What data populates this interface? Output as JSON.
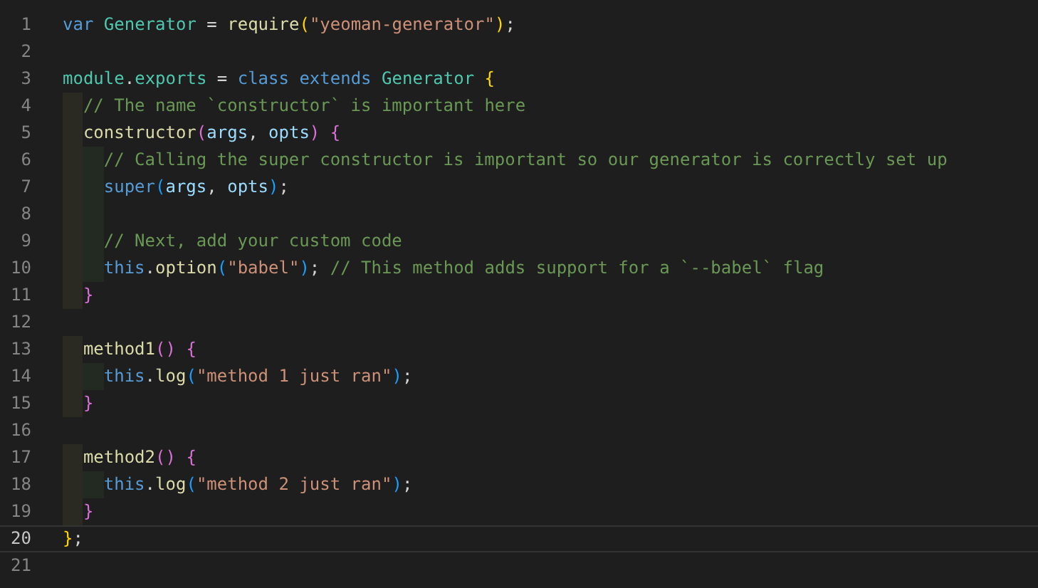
{
  "editor": {
    "lines": [
      {
        "number": "1",
        "current": false,
        "tokens": [
          {
            "kind": "keyword",
            "text": "var "
          },
          {
            "kind": "class",
            "text": "Generator"
          },
          {
            "kind": "plain",
            "text": " = "
          },
          {
            "kind": "function",
            "text": "require"
          },
          {
            "kind": "bracket1",
            "text": "("
          },
          {
            "kind": "string",
            "text": "\"yeoman-generator\""
          },
          {
            "kind": "bracket1",
            "text": ")"
          },
          {
            "kind": "plain",
            "text": ";"
          }
        ]
      },
      {
        "number": "2",
        "current": false
      },
      {
        "number": "3",
        "current": false,
        "tokens": [
          {
            "kind": "class",
            "text": "module"
          },
          {
            "kind": "plain",
            "text": "."
          },
          {
            "kind": "class",
            "text": "exports"
          },
          {
            "kind": "plain",
            "text": " = "
          },
          {
            "kind": "keyword",
            "text": "class extends "
          },
          {
            "kind": "class",
            "text": "Generator "
          },
          {
            "kind": "bracket1",
            "text": "{"
          }
        ]
      },
      {
        "number": "4",
        "current": false,
        "guides": [
          {
            "kind": "outer"
          }
        ],
        "tokens": [
          {
            "kind": "comment",
            "text": "// The name `constructor` is important here"
          }
        ]
      },
      {
        "number": "5",
        "current": false,
        "guides": [
          {
            "kind": "outer"
          }
        ],
        "tokens": [
          {
            "kind": "function",
            "text": "constructor"
          },
          {
            "kind": "bracket2",
            "text": "("
          },
          {
            "kind": "variable",
            "text": "args"
          },
          {
            "kind": "plain",
            "text": ", "
          },
          {
            "kind": "variable",
            "text": "opts"
          },
          {
            "kind": "bracket2",
            "text": ") {"
          }
        ]
      },
      {
        "number": "6",
        "current": false,
        "guides": [
          {
            "kind": "outer"
          },
          {
            "kind": "inner"
          }
        ],
        "tokens": [
          {
            "kind": "comment",
            "text": "// Calling the super constructor is important so our generator is correctly set up"
          }
        ]
      },
      {
        "number": "7",
        "current": false,
        "guides": [
          {
            "kind": "outer"
          },
          {
            "kind": "inner"
          }
        ],
        "tokens": [
          {
            "kind": "keyword",
            "text": "super"
          },
          {
            "kind": "bracket3",
            "text": "("
          },
          {
            "kind": "variable",
            "text": "args"
          },
          {
            "kind": "plain",
            "text": ", "
          },
          {
            "kind": "variable",
            "text": "opts"
          },
          {
            "kind": "bracket3",
            "text": ")"
          },
          {
            "kind": "plain",
            "text": ";"
          }
        ]
      },
      {
        "number": "8",
        "current": false,
        "guides": [
          {
            "kind": "outer"
          },
          {
            "kind": "inner"
          }
        ]
      },
      {
        "number": "9",
        "current": false,
        "guides": [
          {
            "kind": "outer"
          },
          {
            "kind": "inner"
          }
        ],
        "tokens": [
          {
            "kind": "comment",
            "text": "// Next, add your custom code"
          }
        ]
      },
      {
        "number": "10",
        "current": false,
        "guides": [
          {
            "kind": "outer"
          },
          {
            "kind": "inner"
          }
        ],
        "tokens": [
          {
            "kind": "keyword",
            "text": "this"
          },
          {
            "kind": "plain",
            "text": "."
          },
          {
            "kind": "function",
            "text": "option"
          },
          {
            "kind": "bracket3",
            "text": "("
          },
          {
            "kind": "string",
            "text": "\"babel\""
          },
          {
            "kind": "bracket3",
            "text": ")"
          },
          {
            "kind": "plain",
            "text": "; "
          },
          {
            "kind": "comment",
            "text": "// This method adds support for a `--babel` flag"
          }
        ]
      },
      {
        "number": "11",
        "current": false,
        "guides": [
          {
            "kind": "outer"
          }
        ],
        "tokens": [
          {
            "kind": "bracket2",
            "text": "}"
          }
        ]
      },
      {
        "number": "12",
        "current": false
      },
      {
        "number": "13",
        "current": false,
        "guides": [
          {
            "kind": "outer"
          }
        ],
        "tokens": [
          {
            "kind": "function",
            "text": "method1"
          },
          {
            "kind": "bracket2",
            "text": "() {"
          }
        ]
      },
      {
        "number": "14",
        "current": false,
        "guides": [
          {
            "kind": "outer"
          },
          {
            "kind": "inner"
          }
        ],
        "tokens": [
          {
            "kind": "keyword",
            "text": "this"
          },
          {
            "kind": "plain",
            "text": "."
          },
          {
            "kind": "function",
            "text": "log"
          },
          {
            "kind": "bracket3",
            "text": "("
          },
          {
            "kind": "string",
            "text": "\"method 1 just ran\""
          },
          {
            "kind": "bracket3",
            "text": ")"
          },
          {
            "kind": "plain",
            "text": ";"
          }
        ]
      },
      {
        "number": "15",
        "current": false,
        "guides": [
          {
            "kind": "outer"
          }
        ],
        "tokens": [
          {
            "kind": "bracket2",
            "text": "}"
          }
        ]
      },
      {
        "number": "16",
        "current": false
      },
      {
        "number": "17",
        "current": false,
        "guides": [
          {
            "kind": "outer"
          }
        ],
        "tokens": [
          {
            "kind": "function",
            "text": "method2"
          },
          {
            "kind": "bracket2",
            "text": "() {"
          }
        ]
      },
      {
        "number": "18",
        "current": false,
        "guides": [
          {
            "kind": "outer"
          },
          {
            "kind": "inner"
          }
        ],
        "tokens": [
          {
            "kind": "keyword",
            "text": "this"
          },
          {
            "kind": "plain",
            "text": "."
          },
          {
            "kind": "function",
            "text": "log"
          },
          {
            "kind": "bracket3",
            "text": "("
          },
          {
            "kind": "string",
            "text": "\"method 2 just ran\""
          },
          {
            "kind": "bracket3",
            "text": ")"
          },
          {
            "kind": "plain",
            "text": ";"
          }
        ]
      },
      {
        "number": "19",
        "current": false,
        "guides": [
          {
            "kind": "outer"
          }
        ],
        "tokens": [
          {
            "kind": "bracket2",
            "text": "}"
          }
        ]
      },
      {
        "number": "20",
        "current": true,
        "tokens": [
          {
            "kind": "bracket1",
            "text": "}"
          },
          {
            "kind": "plain",
            "text": ";"
          }
        ]
      },
      {
        "number": "21",
        "current": false
      }
    ]
  }
}
